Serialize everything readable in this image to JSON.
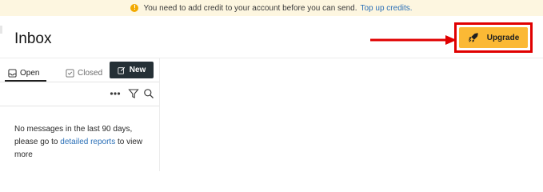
{
  "banner": {
    "text": "You need to add credit to your account before you can send.",
    "link": "Top up credits.",
    "icon": "warning-icon",
    "color": "#fdf6e0"
  },
  "header": {
    "title": "Inbox",
    "upgrade_label": "Upgrade",
    "upgrade_icon": "rocket-icon",
    "upgrade_color": "#fbb935",
    "highlight_color": "#e00000"
  },
  "tabs": [
    {
      "label": "Open",
      "icon": "inbox-tray-icon",
      "active": true
    },
    {
      "label": "Closed",
      "icon": "closed-check-icon",
      "active": false
    }
  ],
  "new_button": {
    "label": "New",
    "icon": "compose-icon",
    "color": "#253036"
  },
  "toolbar": {
    "icons": [
      "more-dots-icon",
      "filter-icon",
      "search-icon"
    ]
  },
  "empty_state": {
    "text_before": "No messages in the last 90 days, please go to",
    "link": "detailed reports",
    "text_after": "to view more"
  }
}
